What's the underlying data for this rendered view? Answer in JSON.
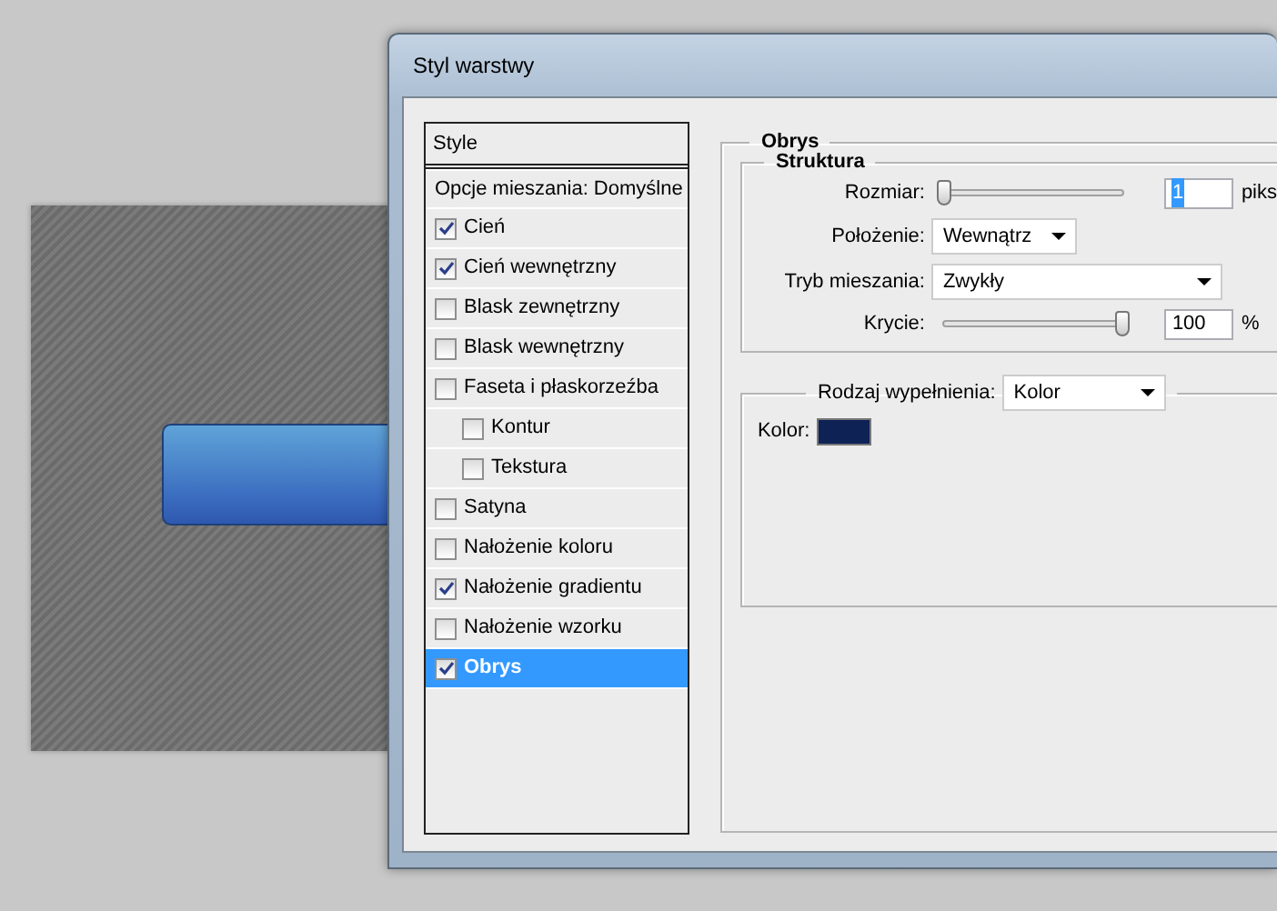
{
  "window": {
    "title": "Styl warstwy"
  },
  "styles_list": {
    "header": "Style",
    "blending_options": "Opcje mieszania: Domyślne",
    "items": [
      {
        "label": "Cień",
        "checked": true,
        "selected": false
      },
      {
        "label": "Cień wewnętrzny",
        "checked": true,
        "selected": false
      },
      {
        "label": "Blask zewnętrzny",
        "checked": false,
        "selected": false
      },
      {
        "label": "Blask wewnętrzny",
        "checked": false,
        "selected": false
      },
      {
        "label": "Faseta i płaskorzeźba",
        "checked": false,
        "selected": false,
        "children": [
          {
            "label": "Kontur",
            "checked": false,
            "selected": false
          },
          {
            "label": "Tekstura",
            "checked": false,
            "selected": false
          }
        ]
      },
      {
        "label": "Satyna",
        "checked": false,
        "selected": false
      },
      {
        "label": "Nałożenie koloru",
        "checked": false,
        "selected": false
      },
      {
        "label": "Nałożenie gradientu",
        "checked": true,
        "selected": false
      },
      {
        "label": "Nałożenie wzorku",
        "checked": false,
        "selected": false
      },
      {
        "label": "Obrys",
        "checked": true,
        "selected": true
      }
    ]
  },
  "stroke": {
    "title": "Obrys",
    "structure": {
      "title": "Struktura",
      "size": {
        "label": "Rozmiar:",
        "level": 0,
        "value": "1",
        "value_selected": true,
        "unit": "piks"
      },
      "position": {
        "label": "Położenie:",
        "value": "Wewnątrz"
      },
      "blend_mode": {
        "label": "Tryb mieszania:",
        "value": "Zwykły"
      },
      "opacity": {
        "label": "Krycie:",
        "level": 1,
        "value": "100",
        "value_selected": false,
        "unit": "%"
      }
    },
    "fill": {
      "type_label": "Rodzaj wypełnienia:",
      "type_value": "Kolor",
      "color_label": "Kolor:",
      "color": "#0e2256"
    }
  }
}
